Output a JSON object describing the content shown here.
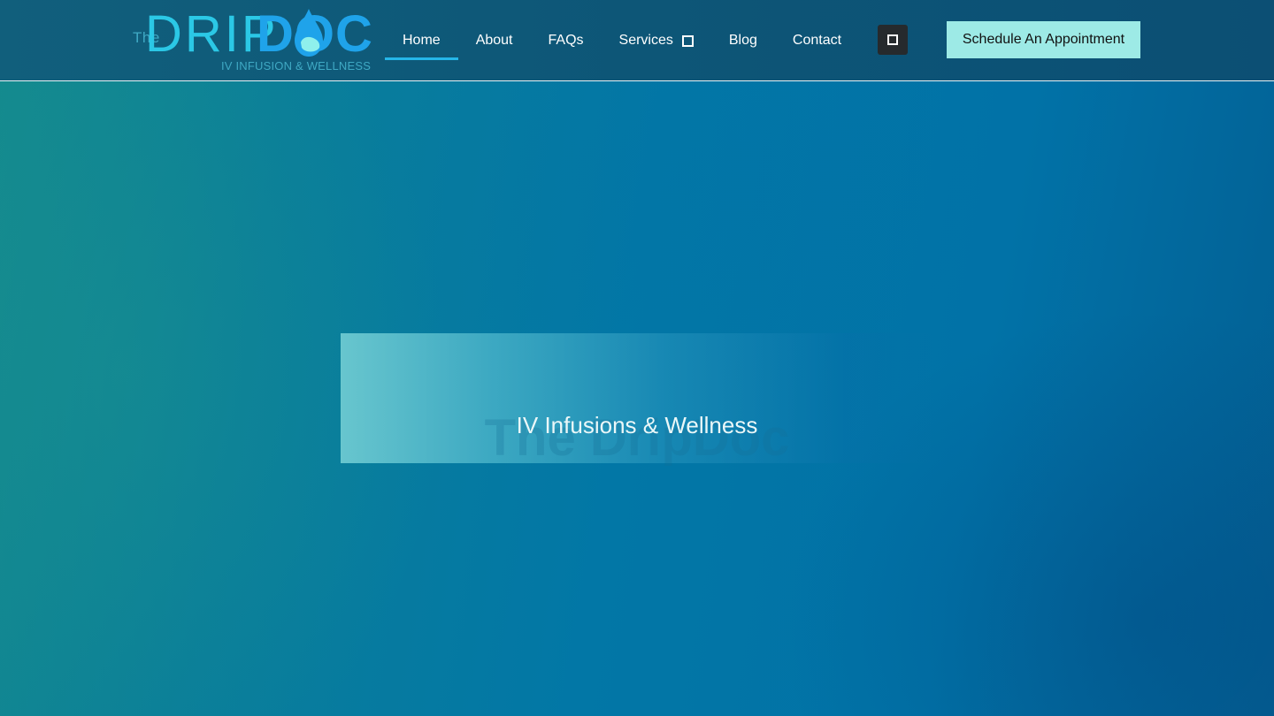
{
  "header": {
    "logo": {
      "the": "The",
      "drip": "DRIP",
      "doc": "DOC",
      "tagline": "IV INFUSION & WELLNESS"
    },
    "nav": [
      {
        "label": "Home",
        "active": true
      },
      {
        "label": "About"
      },
      {
        "label": "FAQs"
      },
      {
        "label": "Services",
        "has_dropdown": true
      },
      {
        "label": "Blog"
      },
      {
        "label": "Contact"
      }
    ],
    "search_icon": "square-icon",
    "cta_label": "Schedule An Appointment"
  },
  "hero": {
    "title": "The DripDoc",
    "subtitle": "IV Infusions & Wellness"
  },
  "colors": {
    "header_bg": "#0d5677",
    "cta_bg": "#9deae6",
    "active_underline": "#25b6e9",
    "logo_light": "#2bc8e6",
    "logo_bold": "#1fa3ea"
  }
}
